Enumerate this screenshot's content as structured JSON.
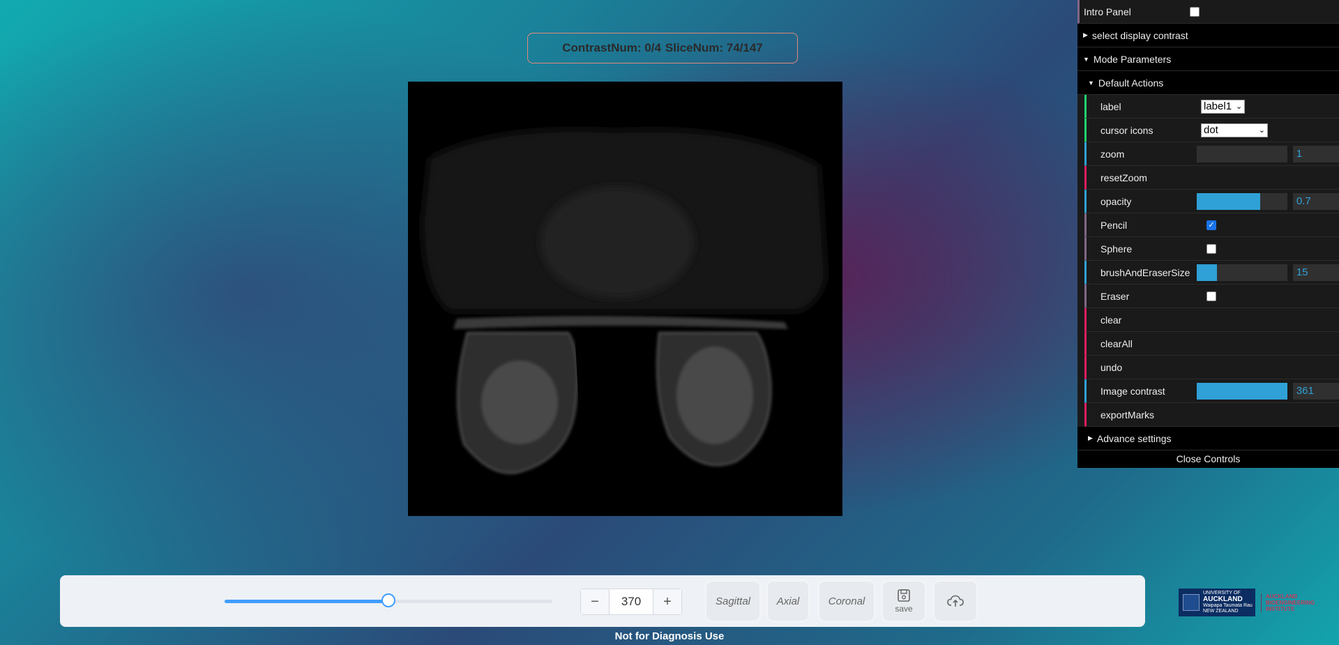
{
  "status": {
    "contrast": "ContrastNum: 0/4",
    "slice": "SliceNum: 74/147"
  },
  "panel": {
    "intro": {
      "label": "Intro Panel",
      "checked": false
    },
    "select_contrast": "select display contrast",
    "mode_parameters": "Mode Parameters",
    "default_actions": "Default Actions",
    "items": {
      "label": {
        "name": "label",
        "value": "label1"
      },
      "cursor": {
        "name": "cursor icons",
        "value": "dot"
      },
      "zoom": {
        "name": "zoom",
        "value": "1",
        "level": 0
      },
      "resetZoom": "resetZoom",
      "opacity": {
        "name": "opacity",
        "value": "0.7",
        "level": 0.7
      },
      "pencil": {
        "name": "Pencil",
        "checked": true
      },
      "sphere": {
        "name": "Sphere",
        "checked": false
      },
      "brush": {
        "name": "brushAndEraserSize",
        "value": "15",
        "level": 0.22
      },
      "eraser": {
        "name": "Eraser",
        "checked": false
      },
      "clear": "clear",
      "clearAll": "clearAll",
      "undo": "undo",
      "contrast": {
        "name": "Image contrast",
        "value": "361",
        "level": 1
      },
      "exportMarks": "exportMarks"
    },
    "advance": "Advance settings",
    "close": "Close Controls"
  },
  "toolbar": {
    "slider_level": 0.5,
    "stepper_value": "370",
    "sagittal": "Sagittal",
    "axial": "Axial",
    "coronal": "Coronal",
    "save": "save"
  },
  "footer": "Not for Diagnosis Use",
  "logo": {
    "uoa_line1": "UNIVERSITY OF",
    "uoa_line2": "AUCKLAND",
    "uoa_line3": "Waipapa Taumata Rau",
    "uoa_line4": "NEW ZEALAND",
    "abi_line1": "AUCKLAND",
    "abi_line2": "BIOENGINEERING",
    "abi_line3": "INSTITUTE"
  },
  "colors": {
    "accent": "#409eff",
    "panel_number": "#2fa1d6",
    "panel_function": "#e61d5f",
    "panel_option": "#1ed36f"
  },
  "icons": {
    "minus": "minus-icon",
    "plus": "plus-icon",
    "save": "save-disk-icon",
    "upload": "cloud-upload-icon",
    "caret": "caret-icon"
  }
}
